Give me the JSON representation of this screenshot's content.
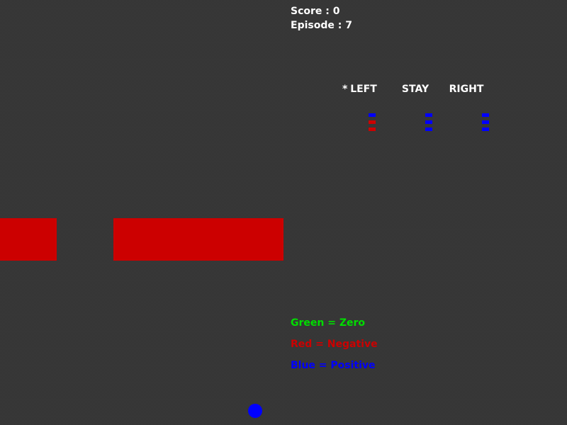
{
  "hud": {
    "score_label": "Score : 0",
    "episode_label": "Episode : 7",
    "score": 0,
    "episode": 7
  },
  "actions": {
    "marker": "*",
    "selected": "LEFT",
    "items": [
      {
        "label": "LEFT",
        "q_signs": [
          "positive",
          "negative",
          "negative"
        ]
      },
      {
        "label": "STAY",
        "q_signs": [
          "positive",
          "positive",
          "positive"
        ]
      },
      {
        "label": "RIGHT",
        "q_signs": [
          "positive",
          "positive",
          "positive"
        ]
      }
    ]
  },
  "legend": {
    "green": "Green = Zero",
    "red": "Red = Negative",
    "blue": "Blue = Positive"
  },
  "colors": {
    "background": "#3a3a3a",
    "text": "#ffffff",
    "zero": "#00dd00",
    "negative": "#cc0000",
    "positive": "#0000ff",
    "wall": "#cc0000",
    "player": "#0000ff"
  },
  "icons": {
    "player": "blue-circle",
    "obstacle": "red-block"
  }
}
